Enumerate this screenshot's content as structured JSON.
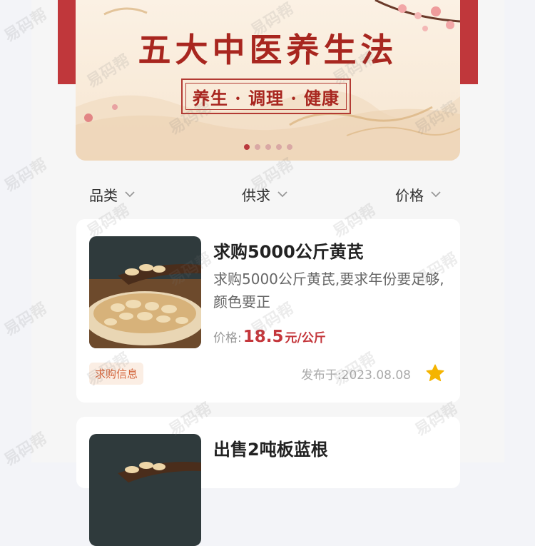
{
  "banner": {
    "title": "五大中医养生法",
    "subtitle": "养生 · 调理 · 健康",
    "dots": [
      true,
      false,
      false,
      false,
      false
    ]
  },
  "filters": [
    {
      "label": "品类",
      "icon": "chevron-down-icon"
    },
    {
      "label": "供求",
      "icon": "chevron-down-icon"
    },
    {
      "label": "价格",
      "icon": "chevron-down-icon"
    }
  ],
  "listings": [
    {
      "title": "求购5000公斤黄芪",
      "description": "求购5000公斤黄芪,要求年份要足够,颜色要正",
      "price_label": "价格:",
      "price": "18.5",
      "price_unit": "元/公斤",
      "tag": "求购信息",
      "date": "发布于:2023.08.08",
      "favorite_icon": "star-icon",
      "favorited": true
    },
    {
      "title": "出售2吨板蓝根"
    }
  ],
  "watermark": "易码帮",
  "colors": {
    "brand_red": "#c0373b",
    "price_red": "#c4373c",
    "tag_text": "#d4663c",
    "tag_bg": "#fbeee4",
    "star": "#f5b400"
  }
}
